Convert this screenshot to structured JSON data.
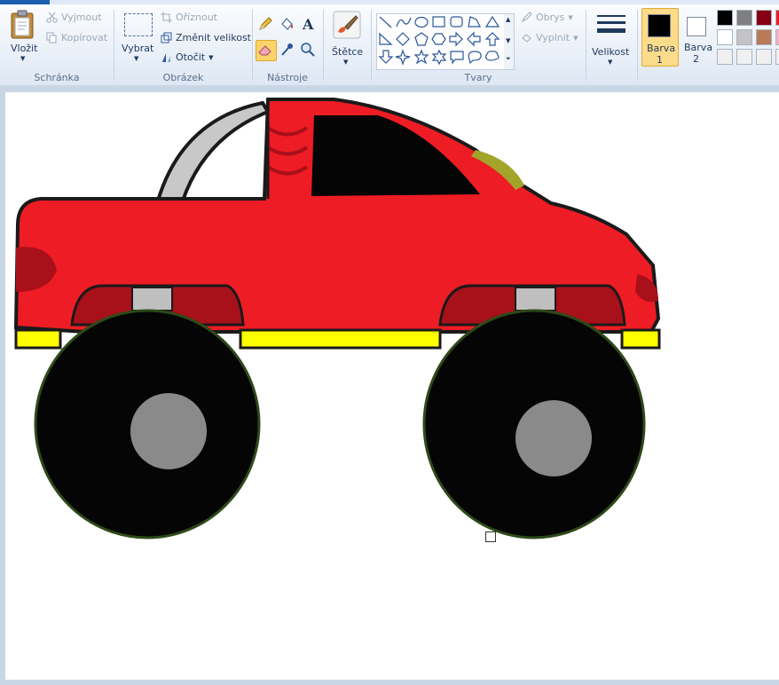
{
  "ribbon": {
    "clipboard": {
      "group_label": "Schránka",
      "paste_label": "Vložit",
      "cut_label": "Vyjmout",
      "copy_label": "Kopírovat"
    },
    "image": {
      "group_label": "Obrázek",
      "select_label": "Vybrat",
      "crop_label": "Oříznout",
      "resize_label": "Změnit velikost",
      "rotate_label": "Otočit"
    },
    "tools": {
      "group_label": "Nástroje"
    },
    "brushes": {
      "label": "Štětce"
    },
    "shapes": {
      "group_label": "Tvary",
      "outline_label": "Obrys",
      "fill_label": "Vyplnit"
    },
    "size": {
      "label": "Velikost"
    },
    "colors": {
      "color1_label": "Barva",
      "color1_num": "1",
      "color2_label": "Barva",
      "color2_num": "2",
      "color1_value": "#000000",
      "color2_value": "#ffffff",
      "palette_row1": [
        "#000000",
        "#7f7f7f",
        "#880015",
        "#ed1c24"
      ],
      "palette_row2": [
        "#ffffff",
        "#c3c3c3",
        "#b97a57",
        "#ffaec9"
      ],
      "palette_row3": [
        "#f0f0f0",
        "#f0f0f0",
        "#f0f0f0",
        "#f0f0f0"
      ]
    }
  },
  "canvas": {
    "picture": "red monster truck",
    "colors": {
      "body": "#ee1c24",
      "body_dark": "#a8101a",
      "trim": "#ffff00",
      "tire": "#050505",
      "hub": "#8a8a8a",
      "window": "#050505",
      "rollbar": "#c8c8c8"
    }
  }
}
